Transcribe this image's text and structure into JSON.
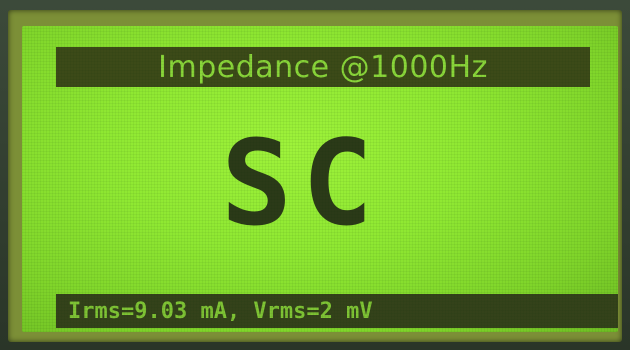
{
  "display": {
    "title": "Impedance @1000Hz",
    "reading": "SC",
    "status": "Irms=9.03 mA, Vrms=2 mV"
  },
  "colors": {
    "lcd_background": "#8fe832",
    "bar_background": "#3c4a18",
    "bar_text": "#8ad63a",
    "reading_text": "#2b3a18"
  }
}
